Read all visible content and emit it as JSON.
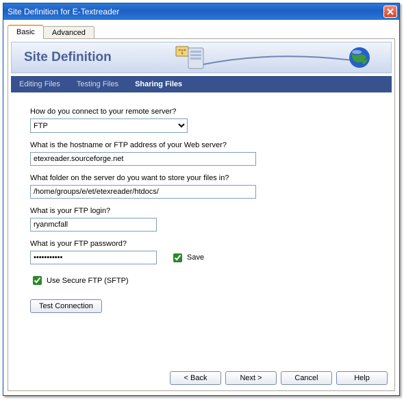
{
  "window": {
    "title": "Site Definition for E-Textreader"
  },
  "tabs": {
    "basic": "Basic",
    "advanced": "Advanced"
  },
  "banner": {
    "title": "Site Definition"
  },
  "steps": {
    "editing": "Editing Files",
    "testing": "Testing Files",
    "sharing": "Sharing Files"
  },
  "form": {
    "connect_label": "How do you connect to your remote server?",
    "connect_value": "FTP",
    "host_label": "What is the hostname or FTP address of your Web server?",
    "host_value": "etexreader.sourceforge.net",
    "folder_label": "What folder on the server do you want to store your files in?",
    "folder_value": "/home/groups/e/et/etexreader/htdocs/",
    "login_label": "What is your FTP login?",
    "login_value": "ryanmcfall",
    "password_label": "What is your FTP password?",
    "password_value": "•••••••••••",
    "save_label": "Save",
    "sftp_label": "Use Secure FTP (SFTP)",
    "test_button": "Test Connection"
  },
  "footer": {
    "back": "< Back",
    "next": "Next >",
    "cancel": "Cancel",
    "help": "Help"
  },
  "colors": {
    "titlebar": "#2a79d8",
    "banner_text": "#4b6196",
    "step_bar": "#37528f",
    "input_border": "#7f9db9"
  }
}
